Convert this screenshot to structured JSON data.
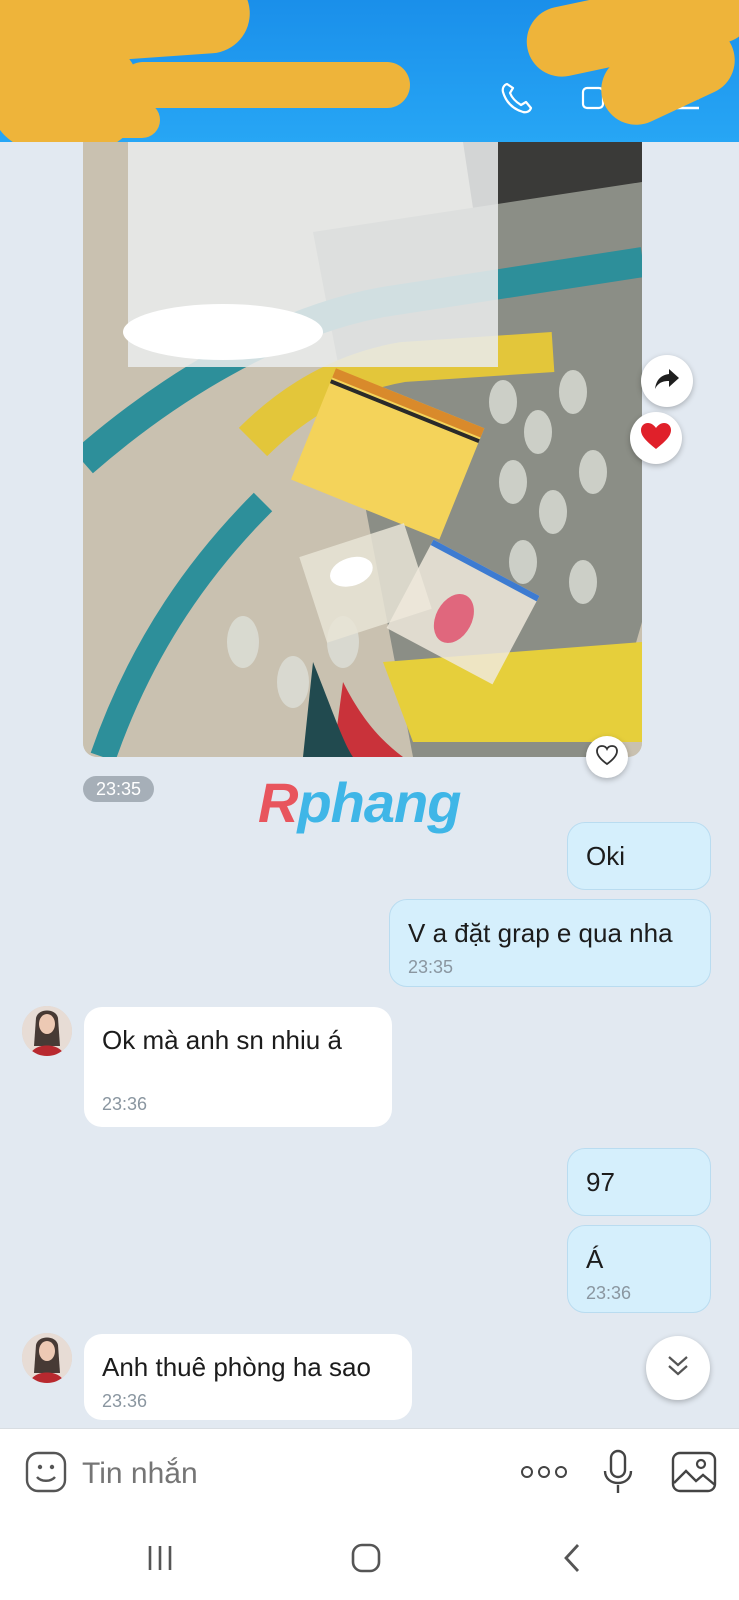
{
  "header": {
    "call_icon": "phone-icon",
    "video_icon": "video-icon",
    "menu_icon": "menu-list-icon"
  },
  "image_message": {
    "time": "23:35",
    "share_icon": "share-arrow-icon",
    "reaction_icon": "red-heart-icon",
    "react_button_icon": "heart-outline-icon"
  },
  "watermark": {
    "first": "R",
    "rest": "phang"
  },
  "messages": [
    {
      "side": "out",
      "text": "Oki",
      "time": ""
    },
    {
      "side": "out",
      "text": "V a đặt grap e qua nha",
      "time": "23:35"
    },
    {
      "side": "in",
      "text": "Ok mà anh sn nhiu á",
      "time": "23:36"
    },
    {
      "side": "out",
      "text": "97",
      "time": ""
    },
    {
      "side": "out",
      "text": "Á",
      "time": "23:36"
    },
    {
      "side": "in",
      "text": "Anh thuê phòng ha sao",
      "time": "23:36"
    }
  ],
  "scroll_down_icon": "double-chevron-down-icon",
  "composer": {
    "placeholder": "Tin nhắn",
    "emoji_icon": "sticker-smile-icon",
    "more_icon": "more-dots-icon",
    "mic_icon": "microphone-icon",
    "gallery_icon": "image-icon"
  },
  "navbar": {
    "recent_icon": "recent-apps-icon",
    "home_icon": "home-icon",
    "back_icon": "back-chevron-icon"
  },
  "colors": {
    "header": "#1a8fea",
    "background": "#e2e9f1",
    "outgoing_bubble": "#d5effc",
    "incoming_bubble": "#ffffff",
    "censor_smear": "#eeb43a"
  }
}
